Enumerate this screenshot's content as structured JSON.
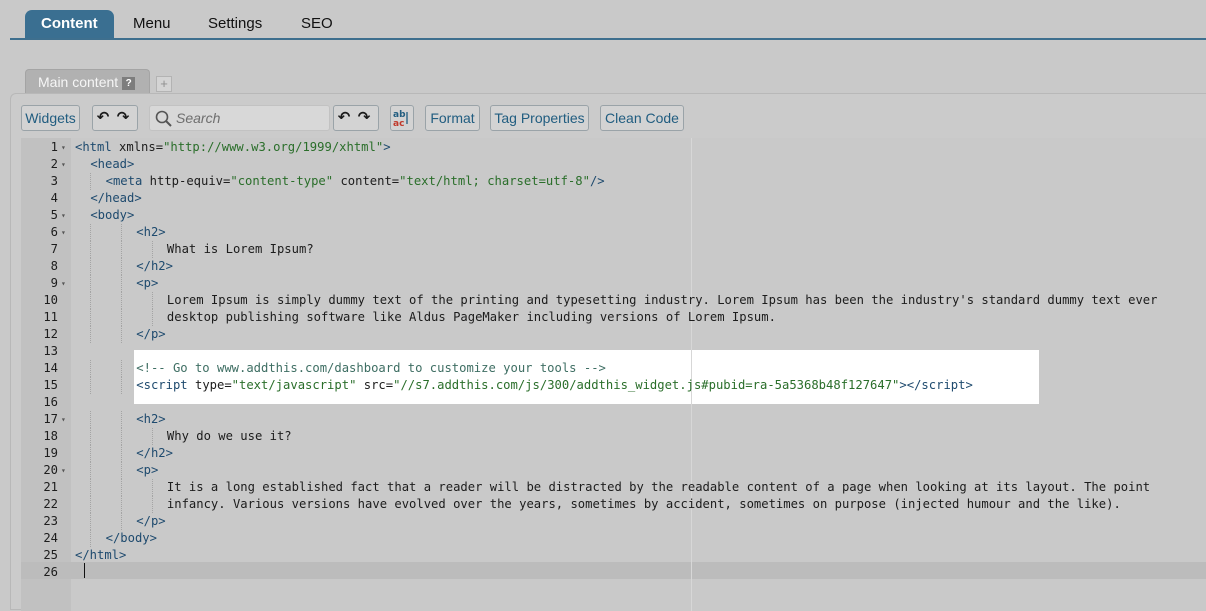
{
  "tabs": [
    {
      "label": "Content",
      "active": true
    },
    {
      "label": "Menu",
      "active": false
    },
    {
      "label": "Settings",
      "active": false
    },
    {
      "label": "SEO",
      "active": false
    }
  ],
  "panel_tab": {
    "label": "Main content",
    "help": "?",
    "add": "+"
  },
  "toolbar": {
    "widgets": "Widgets",
    "search_placeholder": "Search",
    "format": "Format",
    "tag_properties": "Tag Properties",
    "clean_code": "Clean Code"
  },
  "colors": {
    "accent": "#3a6f91",
    "button_text": "#215d80",
    "highlight": "#ffffff"
  },
  "code_lines": [
    {
      "n": "1",
      "fold": true,
      "indent": 0,
      "segs": [
        [
          "t",
          "<html"
        ],
        [
          "a",
          " xmlns="
        ],
        [
          "s",
          "\"http://www.w3.org/1999/xhtml\""
        ],
        [
          "t",
          ">"
        ]
      ]
    },
    {
      "n": "2",
      "fold": true,
      "indent": 2,
      "segs": [
        [
          "t",
          "<head>"
        ]
      ]
    },
    {
      "n": "3",
      "fold": false,
      "indent": 4,
      "segs": [
        [
          "t",
          "<meta"
        ],
        [
          "a",
          " http-equiv="
        ],
        [
          "s",
          "\"content-type\""
        ],
        [
          "a",
          " content="
        ],
        [
          "s",
          "\"text/html; charset=utf-8\""
        ],
        [
          "t",
          "/>"
        ]
      ]
    },
    {
      "n": "4",
      "fold": false,
      "indent": 2,
      "segs": [
        [
          "t",
          "</head>"
        ]
      ]
    },
    {
      "n": "5",
      "fold": true,
      "indent": 2,
      "segs": [
        [
          "t",
          "<body>"
        ]
      ]
    },
    {
      "n": "6",
      "fold": true,
      "indent": 8,
      "segs": [
        [
          "t",
          "<h2>"
        ]
      ]
    },
    {
      "n": "7",
      "fold": false,
      "indent": 12,
      "segs": [
        [
          "a",
          "What is Lorem Ipsum?"
        ]
      ]
    },
    {
      "n": "8",
      "fold": false,
      "indent": 8,
      "segs": [
        [
          "t",
          "</h2>"
        ]
      ]
    },
    {
      "n": "9",
      "fold": true,
      "indent": 8,
      "segs": [
        [
          "t",
          "<p>"
        ]
      ]
    },
    {
      "n": "10",
      "fold": false,
      "indent": 12,
      "segs": [
        [
          "a",
          "Lorem Ipsum is simply dummy text of the printing and typesetting industry. Lorem Ipsum has been the industry's standard dummy text ever"
        ]
      ]
    },
    {
      "n": "11",
      "fold": false,
      "indent": 12,
      "segs": [
        [
          "a",
          "desktop publishing software like Aldus PageMaker including versions of Lorem Ipsum."
        ]
      ]
    },
    {
      "n": "12",
      "fold": false,
      "indent": 8,
      "segs": [
        [
          "t",
          "</p>"
        ]
      ]
    },
    {
      "n": "13",
      "fold": false,
      "indent": 0,
      "segs": []
    },
    {
      "n": "14",
      "fold": false,
      "indent": 8,
      "segs": [
        [
          "c",
          "<!-- Go to www.addthis.com/dashboard to customize your tools -->"
        ]
      ]
    },
    {
      "n": "15",
      "fold": false,
      "indent": 8,
      "segs": [
        [
          "t",
          "<script"
        ],
        [
          "a",
          " type="
        ],
        [
          "s",
          "\"text/javascript\""
        ],
        [
          "a",
          " src="
        ],
        [
          "s",
          "\"//s7.addthis.com/js/300/addthis_widget.js#pubid=ra-5a5368b48f127647\""
        ],
        [
          "t",
          "></scr"
        ],
        [
          "t",
          "ipt>"
        ]
      ]
    },
    {
      "n": "16",
      "fold": false,
      "indent": 0,
      "segs": []
    },
    {
      "n": "17",
      "fold": true,
      "indent": 8,
      "segs": [
        [
          "t",
          "<h2>"
        ]
      ]
    },
    {
      "n": "18",
      "fold": false,
      "indent": 12,
      "segs": [
        [
          "a",
          "Why do we use it?"
        ]
      ]
    },
    {
      "n": "19",
      "fold": false,
      "indent": 8,
      "segs": [
        [
          "t",
          "</h2>"
        ]
      ]
    },
    {
      "n": "20",
      "fold": true,
      "indent": 8,
      "segs": [
        [
          "t",
          "<p>"
        ]
      ]
    },
    {
      "n": "21",
      "fold": false,
      "indent": 12,
      "segs": [
        [
          "a",
          "It is a long established fact that a reader will be distracted by the readable content of a page when looking at its layout. The point"
        ]
      ]
    },
    {
      "n": "22",
      "fold": false,
      "indent": 12,
      "segs": [
        [
          "a",
          "infancy. Various versions have evolved over the years, sometimes by accident, sometimes on purpose (injected humour and the like)."
        ]
      ]
    },
    {
      "n": "23",
      "fold": false,
      "indent": 8,
      "segs": [
        [
          "t",
          "</p>"
        ]
      ]
    },
    {
      "n": "24",
      "fold": false,
      "indent": 4,
      "segs": [
        [
          "t",
          "</body>"
        ]
      ]
    },
    {
      "n": "25",
      "fold": false,
      "indent": 0,
      "segs": [
        [
          "t",
          "</html>"
        ]
      ]
    },
    {
      "n": "26",
      "fold": false,
      "indent": 0,
      "segs": []
    }
  ]
}
